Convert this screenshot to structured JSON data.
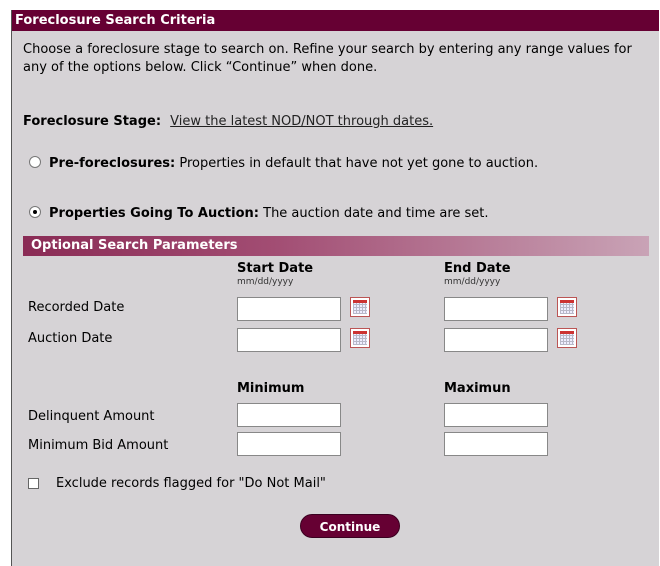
{
  "title": "Foreclosure Search Criteria",
  "intro": "Choose a foreclosure stage to search on. Refine your search by entering any range values for any of the options below. Click “Continue” when done.",
  "stage": {
    "label": "Foreclosure Stage:",
    "link": "View the latest NOD/NOT through dates."
  },
  "options": [
    {
      "bold": "Pre-foreclosures:",
      "text": "Properties in default that have not yet gone to auction.",
      "selected": false
    },
    {
      "bold": "Properties Going To Auction:",
      "text": "The auction date and time are set.",
      "selected": true
    }
  ],
  "optional": {
    "header": "Optional Search Parameters",
    "date_cols": {
      "start": "Start Date",
      "end": "End Date",
      "format": "mm/dd/yyyy"
    },
    "date_rows": [
      "Recorded Date",
      "Auction Date"
    ],
    "amount_cols": {
      "min": "Minimum",
      "max": "Maximun"
    },
    "amount_rows": [
      "Delinquent Amount",
      "Minimum Bid Amount"
    ],
    "exclude_label": "Exclude records flagged for \"Do Not Mail\""
  },
  "continue_label": "Continue"
}
